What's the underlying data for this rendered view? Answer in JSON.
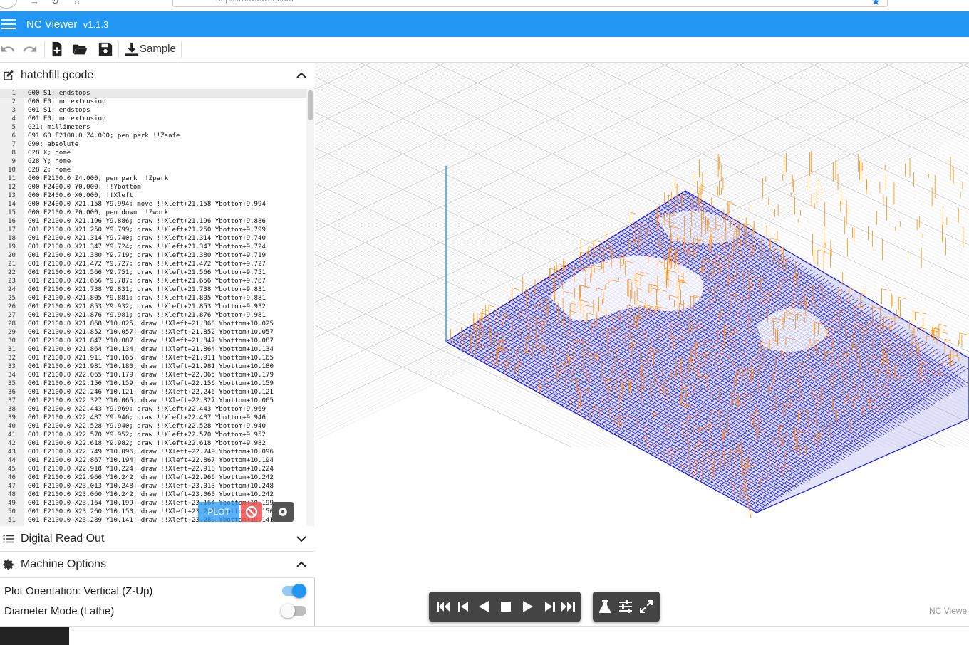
{
  "browser": {
    "url": "https://ncviewer.com"
  },
  "app": {
    "title": "NC Viewer",
    "version": "v1.1.3"
  },
  "toolbar": {
    "sample_label": "Sample",
    "icons": [
      "undo-icon",
      "redo-icon",
      "new-file-icon",
      "open-folder-icon",
      "save-icon",
      "download-icon"
    ]
  },
  "file_panel": {
    "filename": "hatchfill.gcode"
  },
  "code": {
    "active_line": 1,
    "lines": [
      "G00 S1; endstops",
      "G00 E0; no extrusion",
      "G01 S1; endstops",
      "G01 E0; no extrusion",
      "G21; millimeters",
      "G91 G0 F2100.0 Z4.000; pen park !!Zsafe",
      "G90; absolute",
      "G28 X; home",
      "G28 Y; home",
      "G28 Z; home",
      "G00 F2100.0 Z4.000; pen park !!Zpark",
      "G00 F2400.0 Y0.000; !!Ybottom",
      "G00 F2400.0 X0.000; !!Xleft",
      "G00 F2400.0 X21.158 Y9.994; move !!Xleft+21.158 Ybottom+9.994",
      "G00 F2100.0 Z0.000; pen down !!Zwork",
      "G01 F2100.0 X21.196 Y9.886; draw !!Xleft+21.196 Ybottom+9.886",
      "G01 F2100.0 X21.250 Y9.799; draw !!Xleft+21.250 Ybottom+9.799",
      "G01 F2100.0 X21.314 Y9.740; draw !!Xleft+21.314 Ybottom+9.740",
      "G01 F2100.0 X21.347 Y9.724; draw !!Xleft+21.347 Ybottom+9.724",
      "G01 F2100.0 X21.380 Y9.719; draw !!Xleft+21.380 Ybottom+9.719",
      "G01 F2100.0 X21.472 Y9.727; draw !!Xleft+21.472 Ybottom+9.727",
      "G01 F2100.0 X21.566 Y9.751; draw !!Xleft+21.566 Ybottom+9.751",
      "G01 F2100.0 X21.656 Y9.787; draw !!Xleft+21.656 Ybottom+9.787",
      "G01 F2100.0 X21.738 Y9.831; draw !!Xleft+21.738 Ybottom+9.831",
      "G01 F2100.0 X21.805 Y9.881; draw !!Xleft+21.805 Ybottom+9.881",
      "G01 F2100.0 X21.853 Y9.932; draw !!Xleft+21.853 Ybottom+9.932",
      "G01 F2100.0 X21.876 Y9.981; draw !!Xleft+21.876 Ybottom+9.981",
      "G01 F2100.0 X21.868 Y10.025; draw !!Xleft+21.868 Ybottom+10.025",
      "G01 F2100.0 X21.852 Y10.057; draw !!Xleft+21.852 Ybottom+10.057",
      "G01 F2100.0 X21.847 Y10.087; draw !!Xleft+21.847 Ybottom+10.087",
      "G01 F2100.0 X21.864 Y10.134; draw !!Xleft+21.864 Ybottom+10.134",
      "G01 F2100.0 X21.911 Y10.165; draw !!Xleft+21.911 Ybottom+10.165",
      "G01 F2100.0 X21.981 Y10.180; draw !!Xleft+21.981 Ybottom+10.180",
      "G01 F2100.0 X22.065 Y10.179; draw !!Xleft+22.065 Ybottom+10.179",
      "G01 F2100.0 X22.156 Y10.159; draw !!Xleft+22.156 Ybottom+10.159",
      "G01 F2100.0 X22.246 Y10.121; draw !!Xleft+22.246 Ybottom+10.121",
      "G01 F2100.0 X22.327 Y10.065; draw !!Xleft+22.327 Ybottom+10.065",
      "G01 F2100.0 X22.443 Y9.969; draw !!Xleft+22.443 Ybottom+9.969",
      "G01 F2100.0 X22.487 Y9.946; draw !!Xleft+22.487 Ybottom+9.946",
      "G01 F2100.0 X22.528 Y9.940; draw !!Xleft+22.528 Ybottom+9.940",
      "G01 F2100.0 X22.570 Y9.952; draw !!Xleft+22.570 Ybottom+9.952",
      "G01 F2100.0 X22.618 Y9.982; draw !!Xleft+22.618 Ybottom+9.982",
      "G01 F2100.0 X22.749 Y10.096; draw !!Xleft+22.749 Ybottom+10.096",
      "G01 F2100.0 X22.867 Y10.194; draw !!Xleft+22.867 Ybottom+10.194",
      "G01 F2100.0 X22.918 Y10.224; draw !!Xleft+22.918 Ybottom+10.224",
      "G01 F2100.0 X22.966 Y10.242; draw !!Xleft+22.966 Ybottom+10.242",
      "G01 F2100.0 X23.013 Y10.248; draw !!Xleft+23.013 Ybottom+10.248",
      "G01 F2100.0 X23.060 Y10.242; draw !!Xleft+23.060 Ybottom+10.242",
      "G01 F2100.0 X23.164 Y10.199; draw !!Xleft+23.164 Ybottom+10.199",
      "G01 F2100.0 X23.260 Y10.150; draw !!Xleft+23.260 Ybottom+10.150",
      "G01 F2100.0 X23.289 Y10.141; draw !!Xleft+23.289 Ybottom+10.141"
    ]
  },
  "float_buttons": {
    "plot_label": "PLOT"
  },
  "panels": {
    "dro_title": "Digital Read Out",
    "machine_title": "Machine Options"
  },
  "machine_options": {
    "plot_orientation_label": "Plot Orientation:",
    "plot_orientation_value": "Vertical (Z-Up)",
    "plot_orientation_on": true,
    "diameter_mode_label": "Diameter Mode (Lathe)",
    "diameter_mode_on": false
  },
  "viewer": {
    "watermark": "NC Viewe"
  },
  "colors": {
    "accent": "#2196f3",
    "toolpath_cut": "#1010e0",
    "toolpath_rapid": "#ff8c00",
    "grid": "#cfcfcf"
  }
}
